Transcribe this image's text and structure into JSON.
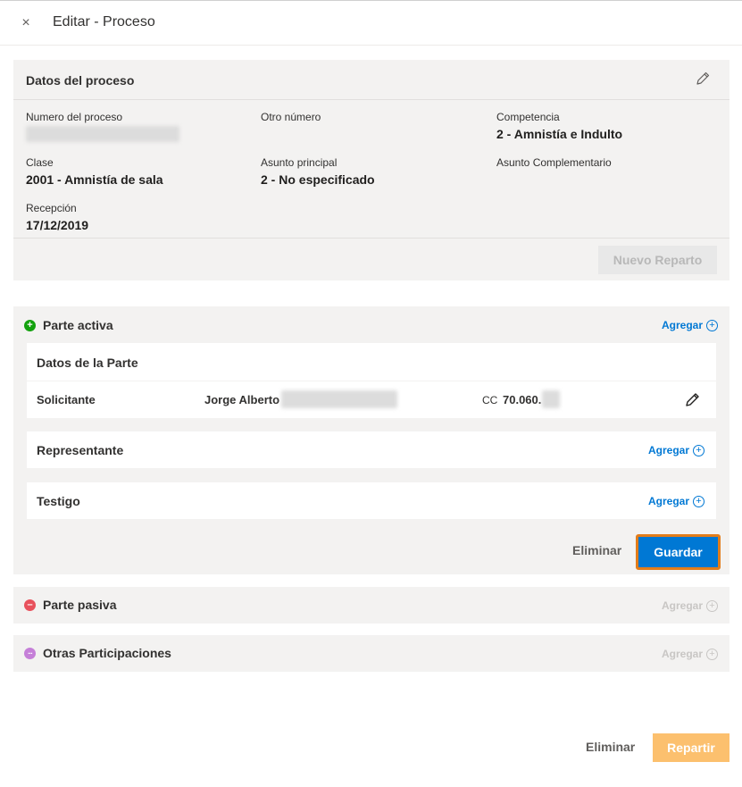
{
  "header": {
    "close_glyph": "×",
    "title": "Editar - Proceso"
  },
  "datos": {
    "title": "Datos del proceso",
    "fields": {
      "numero": {
        "label": "Numero del proceso"
      },
      "otro": {
        "label": "Otro número"
      },
      "competencia": {
        "label": "Competencia",
        "value": "2 - Amnistía e Indulto"
      },
      "clase": {
        "label": "Clase",
        "value": "2001 - Amnistía de sala"
      },
      "asunto_principal": {
        "label": "Asunto principal",
        "value": "2 - No especificado"
      },
      "asunto_complementario": {
        "label": "Asunto Complementario"
      },
      "recepcion": {
        "label": "Recepción",
        "value": "17/12/2019"
      }
    },
    "nuevo_reparto_label": "Nuevo Reparto"
  },
  "parte_activa": {
    "title": "Parte activa",
    "icon_glyph": "+",
    "agregar": "Agregar",
    "datos_header": "Datos de la Parte",
    "row": {
      "rol": "Solicitante",
      "nombre": "Jorge Alberto",
      "doc_tipo": "CC",
      "doc_num": "70.060."
    },
    "representante": "Representante",
    "testigo": "Testigo",
    "eliminar": "Eliminar",
    "guardar": "Guardar"
  },
  "parte_pasiva": {
    "title": "Parte pasiva",
    "icon_glyph": "–",
    "agregar": "Agregar"
  },
  "otras": {
    "title": "Otras Participaciones",
    "icon_glyph": "···",
    "agregar": "Agregar"
  },
  "footer": {
    "eliminar": "Eliminar",
    "repartir": "Repartir"
  },
  "colors": {
    "primary": "#0078d4",
    "highlight_border": "#e37d1a",
    "repartir_bg": "#fcc06e",
    "activa_icon": "#13a10e",
    "pasiva_icon": "#e8515c",
    "otras_icon": "#c57fd8"
  },
  "icons": {
    "close": "close-icon",
    "edit": "pencil-icon",
    "add": "plus-circle-icon",
    "activa": "plus-circle-filled-icon",
    "pasiva": "minus-circle-filled-icon",
    "otras": "more-circle-filled-icon"
  }
}
